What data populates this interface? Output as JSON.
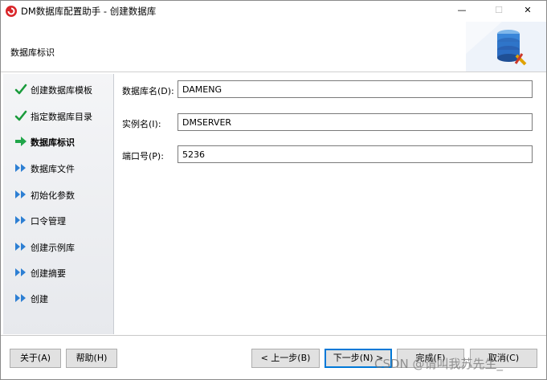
{
  "window": {
    "title": "DM数据库配置助手 - 创建数据库",
    "minimize": "—",
    "maximize": "☐",
    "close": "✕"
  },
  "header": {
    "title": "数据库标识"
  },
  "nav": {
    "items": [
      {
        "label": "创建数据库模板",
        "status": "done",
        "icon": "check-icon"
      },
      {
        "label": "指定数据库目录",
        "status": "done",
        "icon": "check-icon"
      },
      {
        "label": "数据库标识",
        "status": "current",
        "icon": "arrow-right-icon"
      },
      {
        "label": "数据库文件",
        "status": "pending",
        "icon": "double-arrow-icon"
      },
      {
        "label": "初始化参数",
        "status": "pending",
        "icon": "double-arrow-icon"
      },
      {
        "label": "口令管理",
        "status": "pending",
        "icon": "double-arrow-icon"
      },
      {
        "label": "创建示例库",
        "status": "pending",
        "icon": "double-arrow-icon"
      },
      {
        "label": "创建摘要",
        "status": "pending",
        "icon": "double-arrow-icon"
      },
      {
        "label": "创建",
        "status": "pending",
        "icon": "double-arrow-icon"
      }
    ]
  },
  "form": {
    "db_name": {
      "label": "数据库名(D):",
      "value": "DAMENG"
    },
    "instance_name": {
      "label": "实例名(I):",
      "value": "DMSERVER"
    },
    "port": {
      "label": "端口号(P):",
      "value": "5236"
    }
  },
  "buttons": {
    "about": "关于(A)",
    "help": "帮助(H)",
    "prev": "< 上一步(B)",
    "next": "下一步(N) >",
    "finish": "完成(F)",
    "cancel": "取消(C)"
  },
  "watermark": "CSDN @请叫我苏先生_",
  "colors": {
    "check": "#1a9b3c",
    "current_arrow": "#21a64a",
    "pending_arrow": "#2d7fd3",
    "default_button_border": "#0078d7"
  }
}
